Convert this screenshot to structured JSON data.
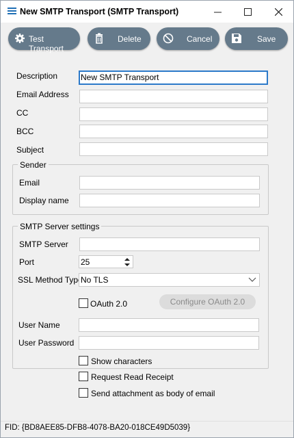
{
  "window": {
    "title": "New SMTP Transport (SMTP Transport)"
  },
  "toolbar": {
    "test_label": "Test Transport",
    "delete_label": "Delete",
    "cancel_label": "Cancel",
    "save_label": "Save"
  },
  "form": {
    "description_label": "Description",
    "description_value": "New SMTP Transport",
    "email_label": "Email Address",
    "email_value": "",
    "cc_label": "CC",
    "cc_value": "",
    "bcc_label": "BCC",
    "bcc_value": "",
    "subject_label": "Subject",
    "subject_value": ""
  },
  "sender": {
    "title": "Sender",
    "email_label": "Email",
    "email_value": "",
    "display_name_label": "Display name",
    "display_name_value": ""
  },
  "smtp": {
    "title": "SMTP Server settings",
    "server_label": "SMTP Server",
    "server_value": "",
    "port_label": "Port",
    "port_value": "25",
    "ssl_label": "SSL Method Type",
    "ssl_value": "No TLS",
    "oauth_label": "OAuth 2.0",
    "oauth_checked": false,
    "configure_oauth_label": "Configure OAuth 2.0",
    "username_label": "User Name",
    "username_value": "",
    "password_label": "User Password",
    "password_value": "",
    "show_chars_label": "Show characters",
    "show_chars_checked": false
  },
  "options": {
    "read_receipt_label": "Request Read Receipt",
    "read_receipt_checked": false,
    "attachment_body_label": "Send attachment as body of email",
    "attachment_body_checked": false
  },
  "footer": {
    "fid_text": "FID: {BD8AEE85-DFB8-4078-BA20-018CE49D5039}"
  },
  "colors": {
    "toolbar_button": "#657a8b",
    "focus_border": "#2b79c9",
    "app_icon": "#1f6fb5"
  }
}
